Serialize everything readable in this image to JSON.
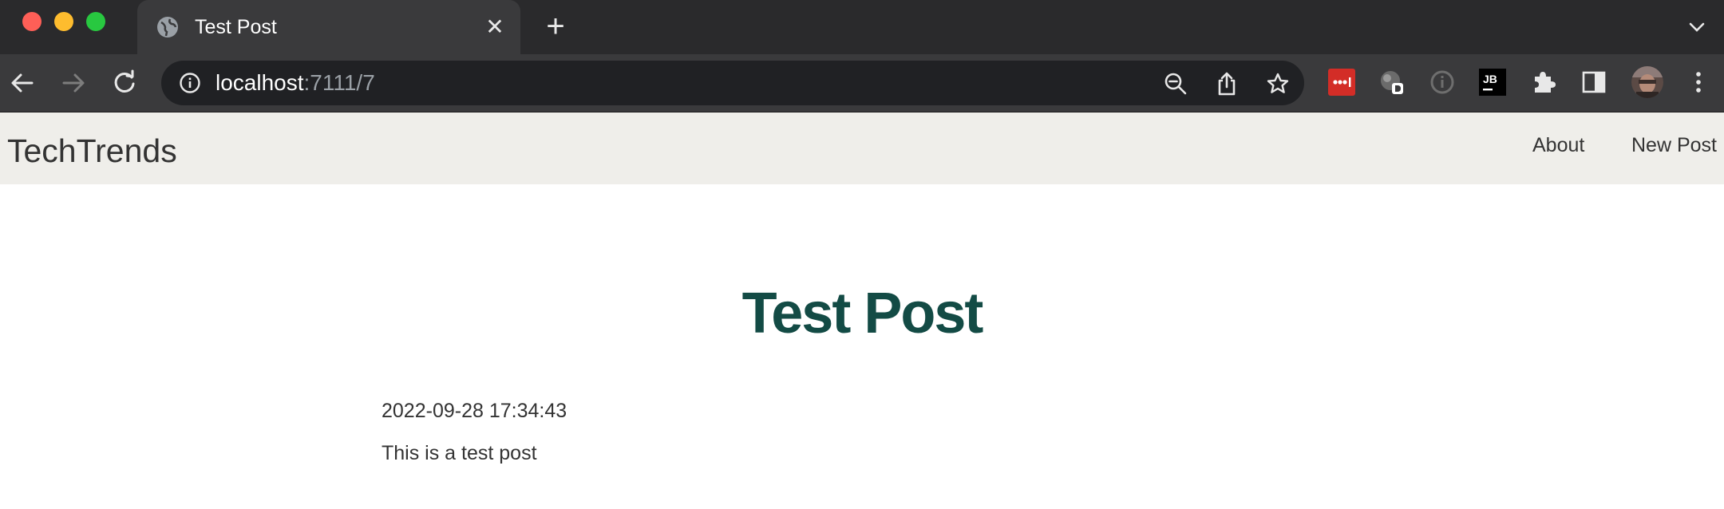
{
  "browser": {
    "tab": {
      "title": "Test Post",
      "close_glyph": "✕"
    },
    "new_tab_glyph": "+",
    "address": {
      "host": "localhost",
      "path": ":7111/7"
    },
    "icons": {
      "tab": "globe-icon",
      "back": "back-arrow-icon",
      "forward": "forward-arrow-icon",
      "reload": "reload-icon",
      "info": "info-icon",
      "zoom": "zoom-out-icon",
      "share": "share-icon",
      "bookmark": "star-icon",
      "extensions": [
        "lastpass-icon",
        "extension-d-icon",
        "extension-info-icon",
        "jetbrains-icon",
        "puzzle-icon",
        "side-panel-icon",
        "profile-avatar-icon",
        "more-menu-icon"
      ]
    },
    "extension_labels": {
      "jetbrains": "JB"
    },
    "colors": {
      "chrome": "#3a3a3c",
      "omnibox": "#202124",
      "lastpass": "#d32d27"
    }
  },
  "site": {
    "brand": "TechTrends",
    "nav": {
      "about": "About",
      "new_post": "New Post"
    },
    "colors": {
      "navbar": "#efeeea",
      "title": "#134b45",
      "text": "#333333"
    }
  },
  "post": {
    "title": "Test Post",
    "created": "2022-09-28 17:34:43",
    "content": "This is a test post"
  }
}
